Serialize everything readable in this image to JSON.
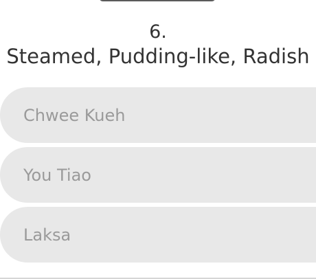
{
  "question": {
    "number": "6.",
    "text": "Steamed, Pudding-like, Radish"
  },
  "options": [
    {
      "label": "Chwee Kueh"
    },
    {
      "label": "You Tiao"
    },
    {
      "label": "Laksa"
    }
  ],
  "colors": {
    "option_background": "#e8e8e8",
    "option_text": "#9a9a9a",
    "question_text": "#333333"
  }
}
